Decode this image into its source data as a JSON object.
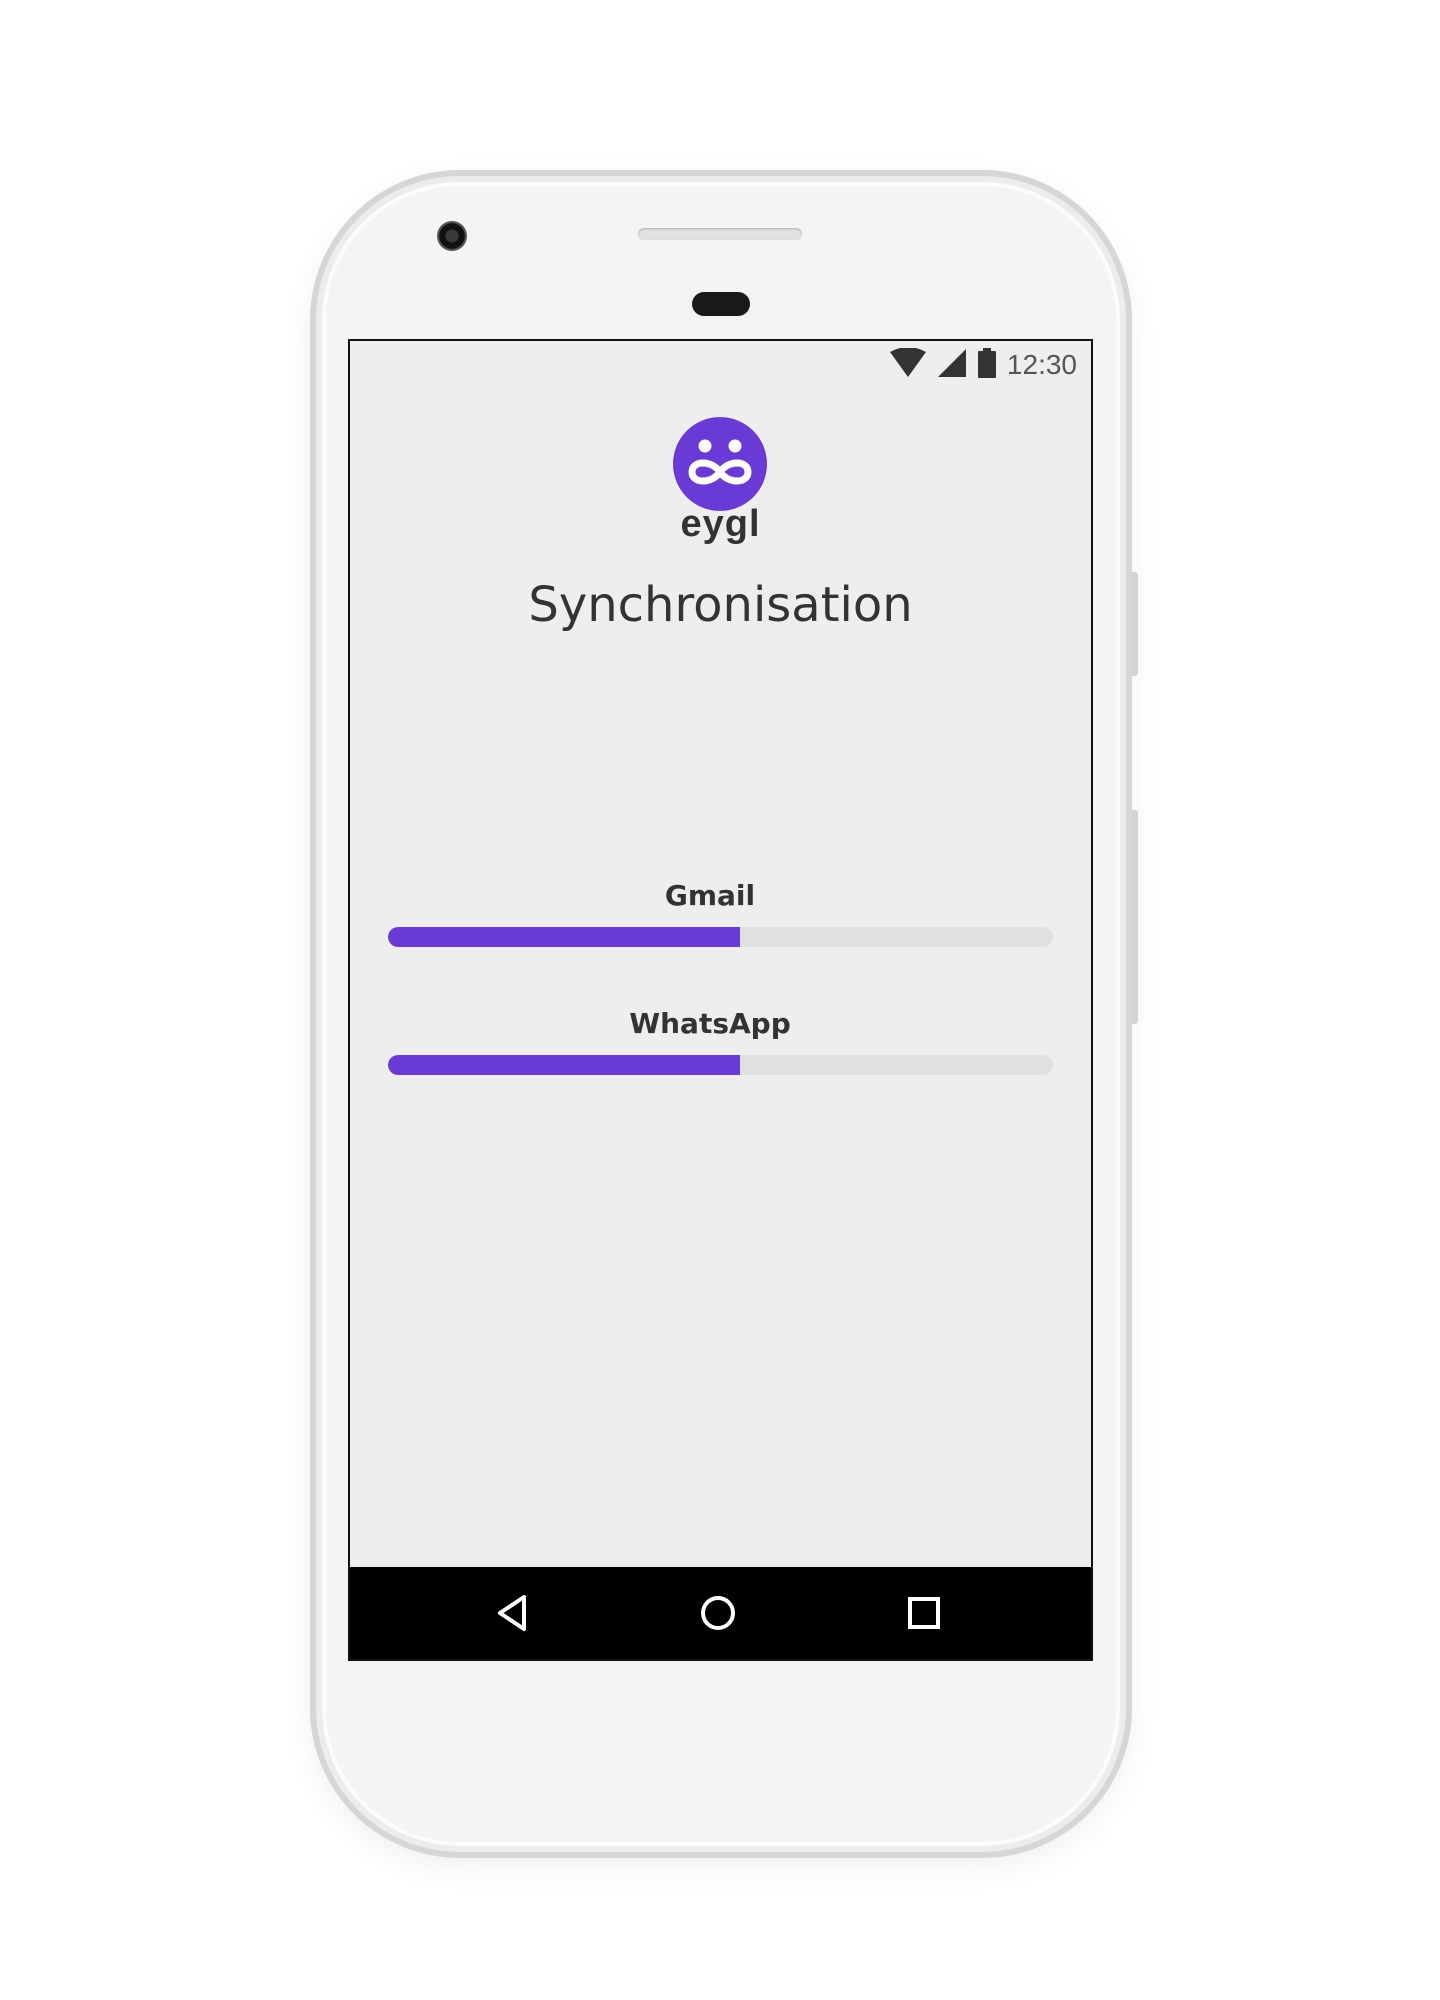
{
  "status_bar": {
    "time": "12:30",
    "icons": [
      "wifi-icon",
      "signal-icon",
      "battery-icon"
    ]
  },
  "app": {
    "brand": "eygl",
    "logo_icon": "eygl-logo-icon",
    "title": "Synchronisation"
  },
  "sync": {
    "items": [
      {
        "label": "Gmail",
        "progress": 0.53
      },
      {
        "label": "WhatsApp",
        "progress": 0.53
      }
    ]
  },
  "nav_bar": {
    "buttons": [
      "back-icon",
      "home-icon",
      "recents-icon"
    ]
  },
  "colors": {
    "accent": "#6a3ad6",
    "track": "#e0e0e0",
    "screen_bg": "#eeeeee",
    "text": "#333333"
  }
}
